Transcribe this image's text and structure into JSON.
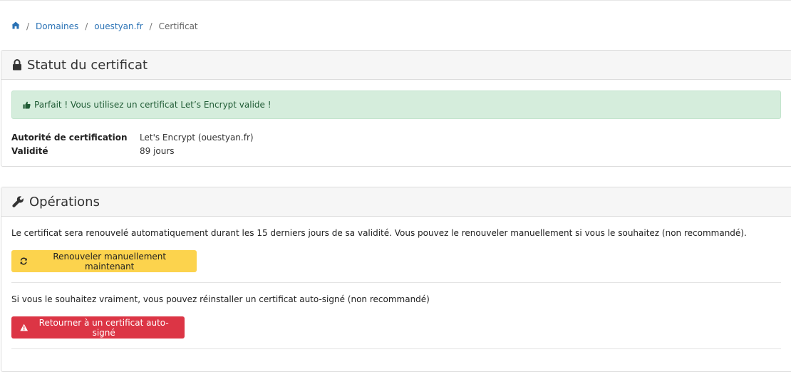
{
  "breadcrumb": {
    "home_icon": "home-icon",
    "items": [
      "Domaines",
      "ouestyan.fr"
    ],
    "current": "Certificat",
    "separator": "/"
  },
  "status_panel": {
    "title": "Statut du certificat",
    "icon": "lock-icon",
    "alert": {
      "icon": "thumbs-up-icon",
      "text": "Parfait ! Vous utilisez un certificat Let’s Encrypt valide !"
    },
    "details": [
      {
        "label": "Autorité de certification",
        "value": "Let's Encrypt (ouestyan.fr)"
      },
      {
        "label": "Validité",
        "value": "89 jours"
      }
    ]
  },
  "operations_panel": {
    "title": "Opérations",
    "icon": "wrench-icon",
    "renew_description": "Le certificat sera renouvelé automatiquement durant les 15 derniers jours de sa validité. Vous pouvez le renouveler manuellement si vous le souhaitez (non recommandé).",
    "renew_button": {
      "label": "Renouveler manuellement maintenant",
      "icon": "refresh-icon"
    },
    "selfsigned_description": "Si vous le souhaitez vraiment, vous pouvez réinstaller un certificat auto-signé (non recommandé)",
    "selfsigned_button": {
      "label": "Retourner à un certificat auto-signé",
      "icon": "warning-icon"
    }
  },
  "colors": {
    "link": "#2a72b5",
    "success_bg": "#d5eddc",
    "warning_button": "#fcd34d",
    "danger_button": "#dc3545"
  }
}
